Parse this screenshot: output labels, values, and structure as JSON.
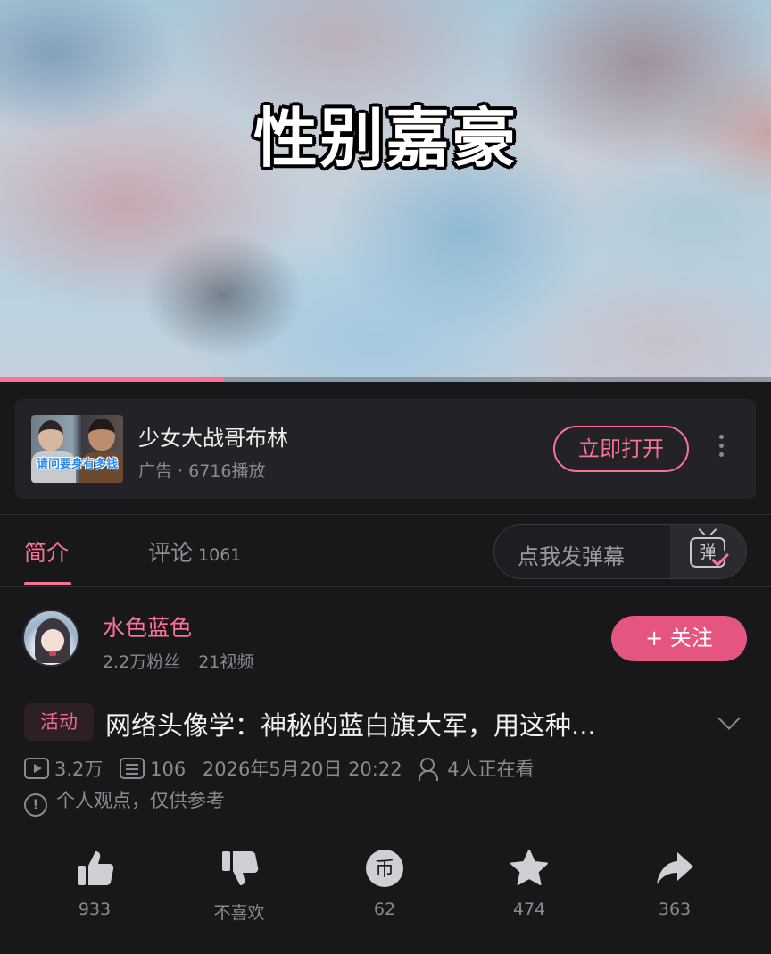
{
  "video": {
    "overlay_title": "性别嘉豪",
    "progress": 0.29
  },
  "ad": {
    "thumb_caption": "请问要身有多钱",
    "title": "少女大战哥布林",
    "subtitle": "广告 · 6716播放",
    "open_label": "立即打开",
    "more_icon": "more-vertical-icon"
  },
  "tabs": {
    "intro_label": "简介",
    "comment_label": "评论",
    "comment_count": "1061"
  },
  "danmu": {
    "placeholder": "点我发弹幕",
    "icon_glyph": "弹"
  },
  "uploader": {
    "name": "水色蓝色",
    "fans": "2.2万粉丝",
    "videos": "21视频",
    "follow_label": "+ 关注"
  },
  "video_info": {
    "tag": "活动",
    "title": "网络头像学：神秘的蓝白旗大军，用这种...",
    "plays": "3.2万",
    "danmaku_count": "106",
    "datetime": "2026年5月20日 20:22",
    "watching": "4人正在看",
    "note": "个人观点，仅供参考",
    "note_icon": "!"
  },
  "actions": {
    "like": "933",
    "dislike": "不喜欢",
    "coin": "62",
    "favorite": "474",
    "share": "363",
    "coin_glyph": "币"
  },
  "colors": {
    "accent": "#fb7299",
    "background": "#18181b",
    "card": "#232327"
  }
}
